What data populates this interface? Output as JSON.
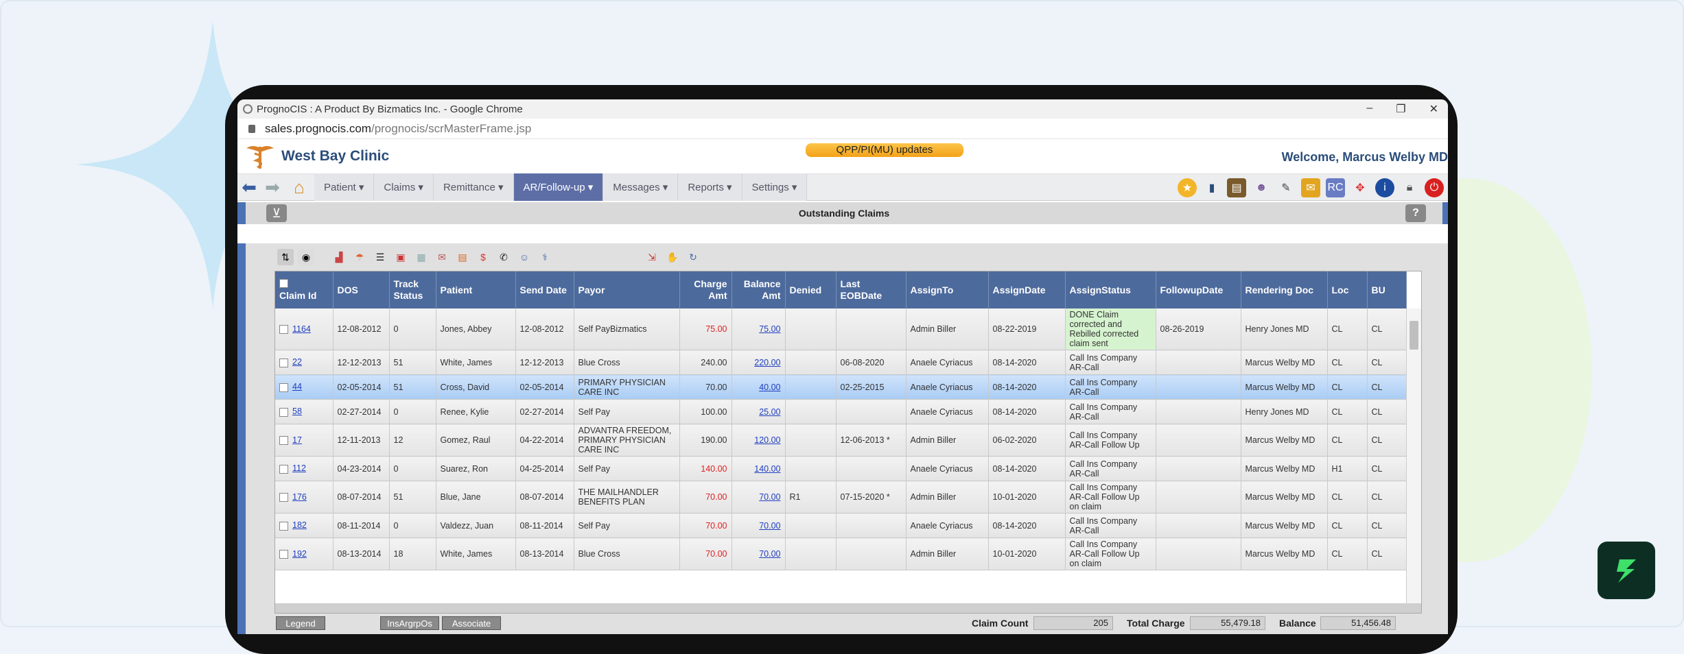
{
  "browser": {
    "window_title": "PrognoCIS : A Product By Bizmatics Inc. - Google Chrome",
    "url_host": "sales.prognocis.com",
    "url_path": "/prognocis/scrMasterFrame.jsp",
    "min": "–",
    "max": "❐",
    "close": "✕"
  },
  "header": {
    "clinic_name": "West Bay Clinic",
    "announcement": "QPP/PI(MU) updates",
    "welcome": "Welcome, Marcus Welby MD"
  },
  "nav": {
    "back": "⬅",
    "forward": "➡",
    "home": "⌂",
    "items": [
      "Patient ▾",
      "Claims ▾",
      "Remittance ▾",
      "AR/Follow-up ▾",
      "Messages ▾",
      "Reports ▾",
      "Settings ▾"
    ],
    "active_index": 3
  },
  "section": {
    "title": "Outstanding Claims",
    "filter": "⊻",
    "help": "?"
  },
  "table": {
    "headers": [
      "Claim Id",
      "DOS",
      "Track Status",
      "Patient",
      "Send Date",
      "Payor",
      "Charge Amt",
      "Balance Amt",
      "Denied",
      "Last EOBDate",
      "AssignTo",
      "AssignDate",
      "AssignStatus",
      "FollowupDate",
      "Rendering Doc",
      "Loc",
      "BU"
    ],
    "rows": [
      [
        "1164",
        "12-08-2012",
        "0",
        "Jones, Abbey",
        "12-08-2012",
        "Self PayBizmatics",
        "75.00",
        "75.00",
        "",
        "",
        "Admin Biller",
        "08-22-2019",
        "DONE Claim corrected and Rebilled corrected claim sent",
        "08-26-2019",
        "Henry Jones MD",
        "CL",
        "CL"
      ],
      [
        "22",
        "12-12-2013",
        "51",
        "White, James",
        "12-12-2013",
        "Blue Cross",
        "240.00",
        "220.00",
        "",
        "06-08-2020",
        "Anaele Cyriacus",
        "08-14-2020",
        "Call Ins Company AR-Call",
        "",
        "Marcus Welby MD",
        "CL",
        "CL"
      ],
      [
        "44",
        "02-05-2014",
        "51",
        "Cross, David",
        "02-05-2014",
        "PRIMARY PHYSICIAN CARE INC",
        "70.00",
        "40.00",
        "",
        "02-25-2015",
        "Anaele Cyriacus",
        "08-14-2020",
        "Call Ins Company AR-Call",
        "",
        "Marcus Welby MD",
        "CL",
        "CL"
      ],
      [
        "58",
        "02-27-2014",
        "0",
        "Renee, Kylie",
        "02-27-2014",
        "Self Pay",
        "100.00",
        "25.00",
        "",
        "",
        "Anaele Cyriacus",
        "08-14-2020",
        "Call Ins Company AR-Call",
        "",
        "Henry Jones MD",
        "CL",
        "CL"
      ],
      [
        "17",
        "12-11-2013",
        "12",
        "Gomez, Raul",
        "04-22-2014",
        "ADVANTRA FREEDOM, PRIMARY PHYSICIAN CARE INC",
        "190.00",
        "120.00",
        "",
        "12-06-2013 *",
        "Admin Biller",
        "06-02-2020",
        "Call Ins Company AR-Call Follow Up",
        "",
        "Marcus Welby MD",
        "CL",
        "CL"
      ],
      [
        "112",
        "04-23-2014",
        "0",
        "Suarez, Ron",
        "04-25-2014",
        "Self Pay",
        "140.00",
        "140.00",
        "",
        "",
        "Anaele Cyriacus",
        "08-14-2020",
        "Call Ins Company AR-Call",
        "",
        "Marcus Welby MD",
        "H1",
        "CL"
      ],
      [
        "176",
        "08-07-2014",
        "51",
        "Blue, Jane",
        "08-07-2014",
        "THE MAILHANDLER BENEFITS PLAN",
        "70.00",
        "70.00",
        "R1",
        "07-15-2020 *",
        "Admin Biller",
        "10-01-2020",
        "Call Ins Company AR-Call Follow Up on claim",
        "",
        "Marcus Welby MD",
        "CL",
        "CL"
      ],
      [
        "182",
        "08-11-2014",
        "0",
        "Valdezz, Juan",
        "08-11-2014",
        "Self Pay",
        "70.00",
        "70.00",
        "",
        "",
        "Anaele Cyriacus",
        "08-14-2020",
        "Call Ins Company AR-Call",
        "",
        "Marcus Welby MD",
        "CL",
        "CL"
      ],
      [
        "192",
        "08-13-2014",
        "18",
        "White, James",
        "08-13-2014",
        "Blue Cross",
        "70.00",
        "70.00",
        "",
        "",
        "Admin Biller",
        "10-01-2020",
        "Call Ins Company AR-Call Follow Up on claim",
        "",
        "Marcus Welby MD",
        "CL",
        "CL"
      ]
    ],
    "selected_row": 2,
    "red_charge_rows": [
      0,
      5,
      6,
      7,
      8
    ],
    "green_status_rows": [
      0
    ]
  },
  "footer": {
    "legend": "Legend",
    "insargrpos": "InsArgrpOs",
    "associate": "Associate",
    "claim_count_label": "Claim Count",
    "claim_count": "205",
    "total_charge_label": "Total Charge",
    "total_charge": "55,479.18",
    "balance_label": "Balance",
    "balance": "51,456.48"
  },
  "colors": {
    "header_blue": "#4d6a9c",
    "nav_active": "#5d6ea6",
    "selected_row": "#bcd7f7",
    "accent_orange": "#f3a218"
  }
}
